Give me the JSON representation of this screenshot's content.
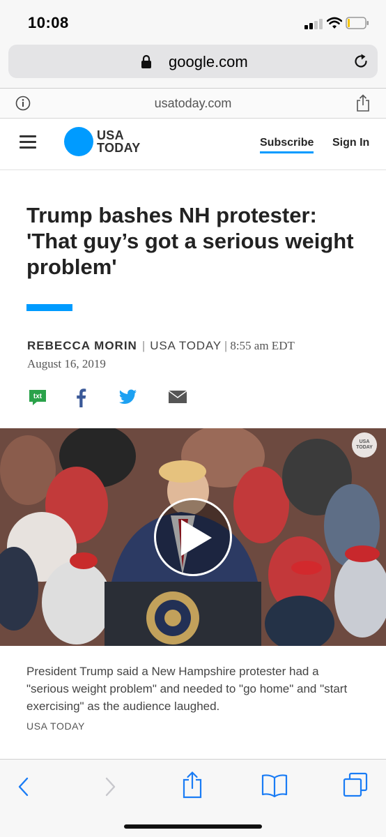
{
  "status_bar": {
    "time": "10:08",
    "signal_bars": 2,
    "battery_level": 0.1
  },
  "browser": {
    "url": "google.com",
    "site_domain": "usatoday.com"
  },
  "site_header": {
    "logo_line1": "USA",
    "logo_line2": "TODAY",
    "subscribe": "Subscribe",
    "sign_in": "Sign In",
    "accent_color": "#009bff"
  },
  "article": {
    "headline": "Trump bashes NH protester: 'That guy’s got a serious weight problem'",
    "author": "REBECCA MORIN",
    "publication": "USA TODAY",
    "time": "8:55 am EDT",
    "date": "August 16, 2019",
    "share_icons": [
      "txt-icon",
      "facebook-icon",
      "twitter-icon",
      "mail-icon"
    ],
    "share_txt_label": "txt"
  },
  "video": {
    "watermark_line1": "USA",
    "watermark_line2": "TODAY",
    "caption": "President Trump said a New Hampshire protester had a \"serious weight problem\" and needed to \"go home\" and \"start exercising\" as the audience laughed.",
    "credit": "USA TODAY"
  },
  "toolbar": {
    "icons": [
      "back-icon",
      "forward-icon",
      "share-icon",
      "bookmarks-icon",
      "tabs-icon"
    ]
  }
}
